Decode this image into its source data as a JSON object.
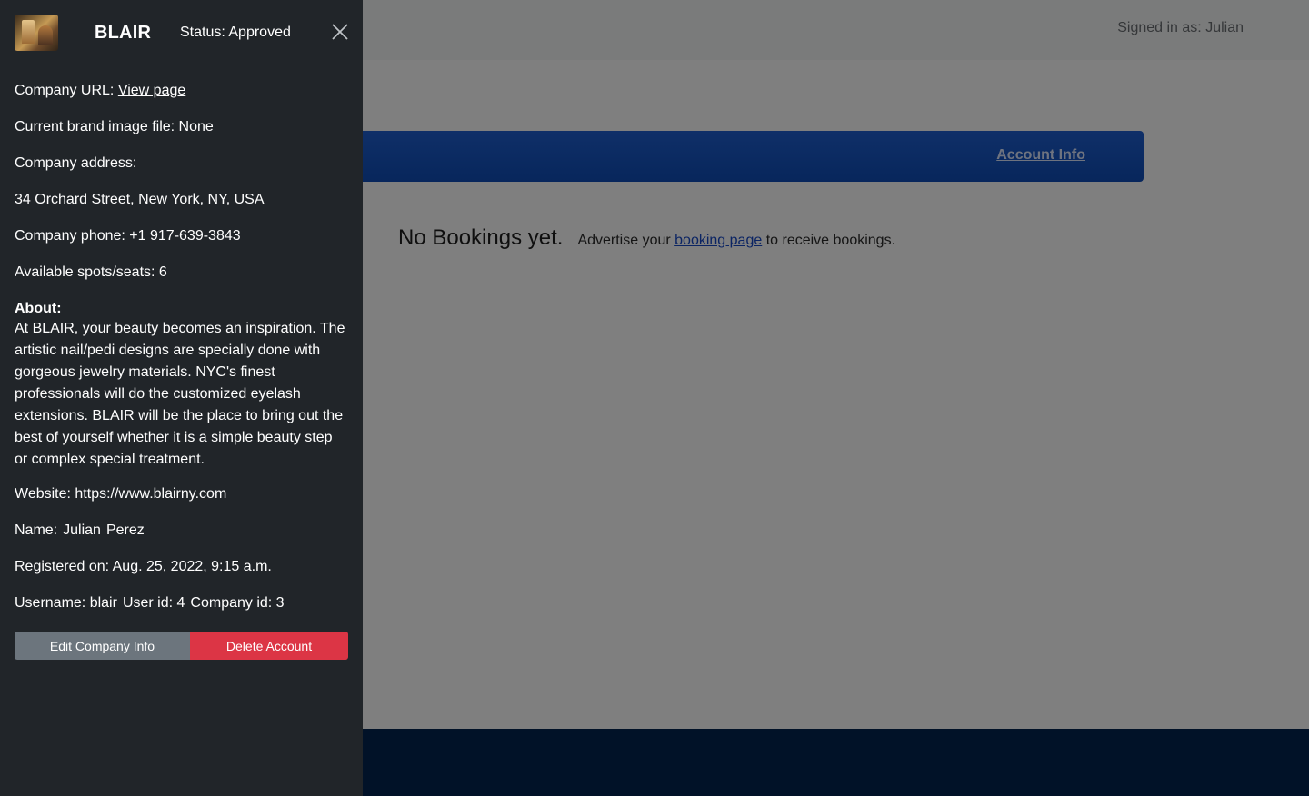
{
  "header": {
    "signed_in": "Signed in as: Julian"
  },
  "nav": {
    "account_info": "Account Info"
  },
  "bookings": {
    "title": "No Bookings yet.",
    "advertise_prefix": "Advertise your",
    "booking_link": "booking page",
    "advertise_suffix": "to receive bookings."
  },
  "panel": {
    "brand": "BLAIR",
    "status": "Status: Approved",
    "company_url_label": "Company URL:",
    "company_url_link": "View page",
    "brand_image": "Current brand image file: None",
    "address_label": "Company address:",
    "address": "34 Orchard Street, New York, NY, USA",
    "phone": "Company phone: +1 917-639-3843",
    "spots": "Available spots/seats: 6",
    "about_label": "About:",
    "about_text": "At BLAIR, your beauty becomes an inspiration. The artistic nail/pedi designs are specially done with gorgeous jewelry materials. NYC's finest professionals will do the customized eyelash extensions. BLAIR will be the place to bring out the best of yourself whether it is a simple beauty step or complex special treatment.",
    "website": "Website: https://www.blairny.com",
    "name_label": "Name:",
    "first_name": "Julian",
    "last_name": "Perez",
    "registered": "Registered on: Aug. 25, 2022, 9:15 a.m.",
    "username": "Username: blair",
    "user_id": "User id: 4",
    "company_id": "Company id: 3",
    "edit_button": "Edit Company Info",
    "delete_button": "Delete Account"
  },
  "icons": {
    "close": "close-icon",
    "logo": "brand-logo"
  },
  "colors": {
    "panel_bg": "#212529",
    "nav_blue": "#0f4db8",
    "footer": "#022550",
    "edit_btn": "#6c757d",
    "delete_btn": "#dc3545"
  }
}
